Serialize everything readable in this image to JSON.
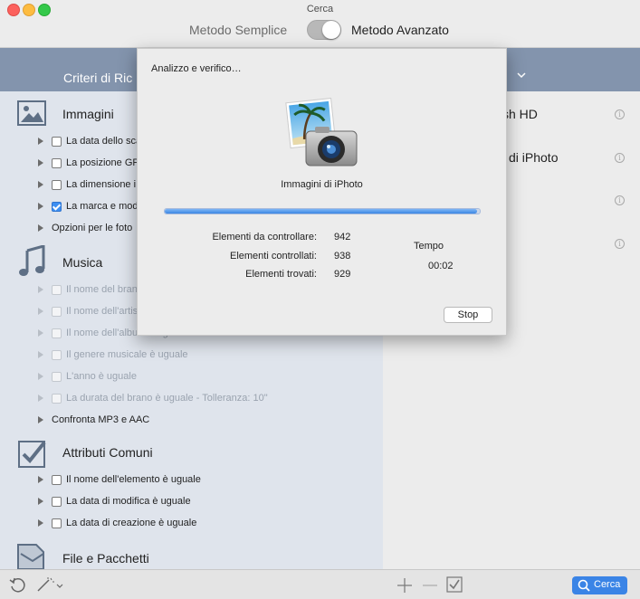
{
  "window": {
    "title": "Cerca"
  },
  "method": {
    "simple": "Metodo Semplice",
    "advanced": "Metodo Avanzato",
    "advanced_enabled": true
  },
  "left_panel": {
    "header_title": "Criteri di Ric",
    "sections": {
      "images": {
        "title": "Immagini",
        "rows": [
          {
            "label": "La data dello sca",
            "checked": false
          },
          {
            "label": "La posizione GP",
            "checked": false
          },
          {
            "label": "La dimensione i",
            "checked": false
          },
          {
            "label": "La marca e mod",
            "checked": true
          },
          {
            "label": "Opzioni per le foto"
          }
        ]
      },
      "music": {
        "title": "Musica",
        "rows": [
          {
            "label": "Il nome del bran"
          },
          {
            "label": "Il nome dell'artis"
          },
          {
            "label": "Il nome dell'album è uguale"
          },
          {
            "label": "Il genere musicale è uguale"
          },
          {
            "label": "L'anno è uguale"
          },
          {
            "label": "La durata del brano è uguale - Tolleranza: 10\""
          },
          {
            "label": "Confronta MP3 e AAC"
          }
        ]
      },
      "common": {
        "title": "Attributi Comuni",
        "rows": [
          {
            "label": "Il nome dell'elemento è uguale",
            "checked": false
          },
          {
            "label": "La data di modifica è uguale",
            "checked": false
          },
          {
            "label": "La data di creazione è uguale",
            "checked": false
          }
        ]
      },
      "files": {
        "title": "File e Pacchetti"
      }
    }
  },
  "right_panel": {
    "items": [
      {
        "label": "sh HD"
      },
      {
        "label": "i di iPhoto"
      }
    ]
  },
  "sheet": {
    "title": "Analizzo e verifico…",
    "caption": "Immagini di iPhoto",
    "progress_fraction": 0.99,
    "stats": [
      {
        "label": "Elementi da controllare:",
        "value": "942"
      },
      {
        "label": "Elementi controllati:",
        "value": "938"
      },
      {
        "label": "Elementi trovati:",
        "value": "929"
      }
    ],
    "time_label": "Tempo",
    "time_value": "00:02",
    "stop_label": "Stop"
  },
  "bottom": {
    "search_label": "Cerca"
  },
  "colors": {
    "accent": "#3a84e6",
    "header": "#8394ad",
    "panel": "#dfe4ec"
  }
}
